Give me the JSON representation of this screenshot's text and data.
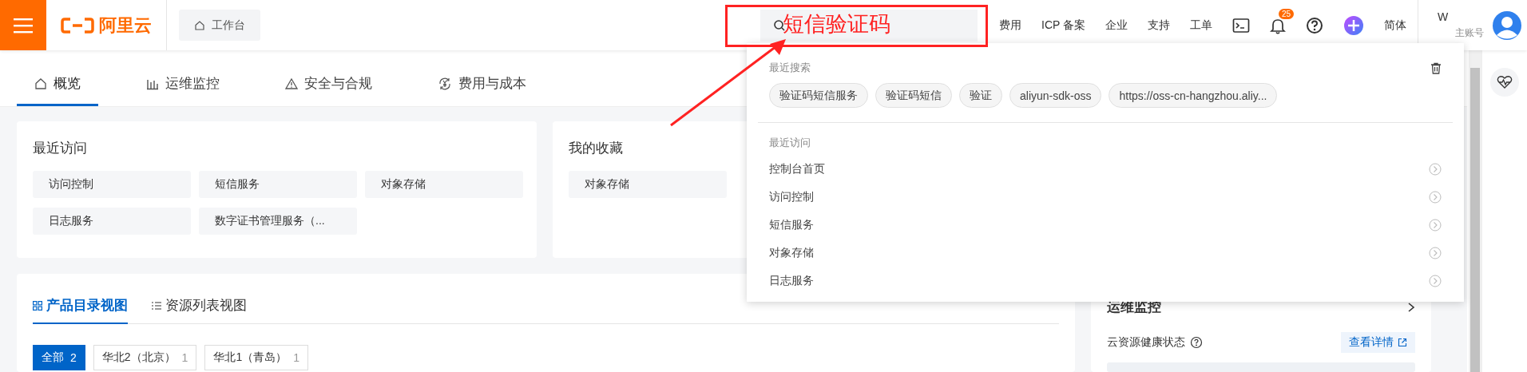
{
  "header": {
    "logo": "阿里云",
    "workbench": "工作台",
    "search": {
      "annotation": "短信验证码"
    },
    "nav": [
      "费用",
      "ICP 备案",
      "企业",
      "支持",
      "工单"
    ],
    "notifications": "25",
    "language": "简体",
    "account": {
      "name": "W",
      "role": "主账号"
    }
  },
  "tabs": [
    {
      "label": "概览",
      "kind": "home",
      "selected": true
    },
    {
      "label": "运维监控",
      "kind": "chart",
      "selected": false
    },
    {
      "label": "安全与合规",
      "kind": "warning",
      "selected": false
    },
    {
      "label": "费用与成本",
      "kind": "cost",
      "selected": false
    }
  ],
  "recent": {
    "title": "最近访问",
    "items": [
      "访问控制",
      "短信服务",
      "对象存储",
      "日志服务",
      "数字证书管理服务（..."
    ]
  },
  "favorites": {
    "title": "我的收藏",
    "items": [
      "对象存储"
    ]
  },
  "catalog": {
    "tabs": [
      {
        "label": "产品目录视图",
        "kind": "grid",
        "selected": true
      },
      {
        "label": "资源列表视图",
        "kind": "list",
        "selected": false
      }
    ],
    "filters": [
      {
        "label": "全部",
        "count": "2",
        "selected": true
      },
      {
        "label": "华北2（北京）",
        "count": "1",
        "selected": false
      },
      {
        "label": "华北1（青岛）",
        "count": "1",
        "selected": false
      }
    ]
  },
  "monitor": {
    "title": "运维监控",
    "health": "云资源健康状态",
    "details": "查看详情"
  },
  "search_dropdown": {
    "recent_searches": {
      "title": "最近搜索",
      "items": [
        "验证码短信服务",
        "验证码短信",
        "验证",
        "aliyun-sdk-oss",
        "https://oss-cn-hangzhou.aliy..."
      ]
    },
    "recent_visits": {
      "title": "最近访问",
      "items": [
        "控制台首页",
        "访问控制",
        "短信服务",
        "对象存储",
        "日志服务"
      ]
    }
  }
}
